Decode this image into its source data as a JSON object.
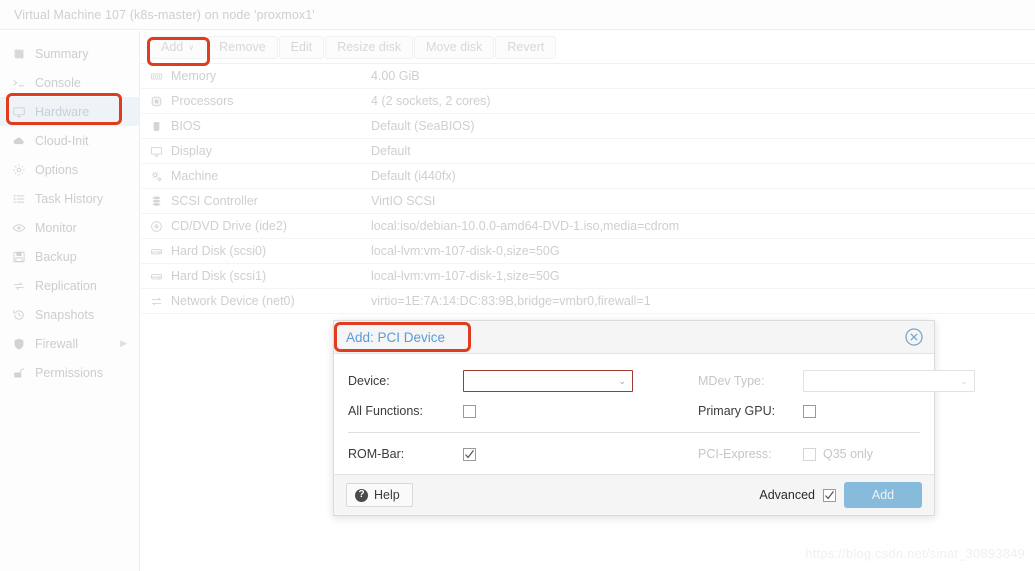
{
  "header": {
    "title": "Virtual Machine 107 (k8s-master) on node 'proxmox1'"
  },
  "sidebar": {
    "items": [
      {
        "label": "Summary",
        "icon": "book-icon",
        "selected": false,
        "submenu": false
      },
      {
        "label": "Console",
        "icon": "terminal-icon",
        "selected": false,
        "submenu": false
      },
      {
        "label": "Hardware",
        "icon": "monitor-icon",
        "selected": true,
        "submenu": false
      },
      {
        "label": "Cloud-Init",
        "icon": "cloud-icon",
        "selected": false,
        "submenu": false
      },
      {
        "label": "Options",
        "icon": "gear-icon",
        "selected": false,
        "submenu": false
      },
      {
        "label": "Task History",
        "icon": "list-icon",
        "selected": false,
        "submenu": false
      },
      {
        "label": "Monitor",
        "icon": "eye-icon",
        "selected": false,
        "submenu": false
      },
      {
        "label": "Backup",
        "icon": "floppy-icon",
        "selected": false,
        "submenu": false
      },
      {
        "label": "Replication",
        "icon": "sync-icon",
        "selected": false,
        "submenu": false
      },
      {
        "label": "Snapshots",
        "icon": "history-icon",
        "selected": false,
        "submenu": false
      },
      {
        "label": "Firewall",
        "icon": "shield-icon",
        "selected": false,
        "submenu": true
      },
      {
        "label": "Permissions",
        "icon": "unlock-icon",
        "selected": false,
        "submenu": false
      }
    ]
  },
  "toolbar": {
    "buttons": [
      {
        "label": "Add",
        "caret": true,
        "enabled": true
      },
      {
        "label": "Remove",
        "caret": false,
        "enabled": false
      },
      {
        "label": "Edit",
        "caret": false,
        "enabled": false
      },
      {
        "label": "Resize disk",
        "caret": false,
        "enabled": false
      },
      {
        "label": "Move disk",
        "caret": false,
        "enabled": false
      },
      {
        "label": "Revert",
        "caret": false,
        "enabled": false
      }
    ],
    "caret_glyph": "∨"
  },
  "hardware": {
    "rows": [
      {
        "icon": "memory-icon",
        "key": "Memory",
        "value": "4.00 GiB"
      },
      {
        "icon": "cpu-icon",
        "key": "Processors",
        "value": "4 (2 sockets, 2 cores)"
      },
      {
        "icon": "bios-icon",
        "key": "BIOS",
        "value": "Default (SeaBIOS)"
      },
      {
        "icon": "display-icon",
        "key": "Display",
        "value": "Default"
      },
      {
        "icon": "gears-icon",
        "key": "Machine",
        "value": "Default (i440fx)"
      },
      {
        "icon": "database-icon",
        "key": "SCSI Controller",
        "value": "VirtIO SCSI"
      },
      {
        "icon": "disc-icon",
        "key": "CD/DVD Drive (ide2)",
        "value": "local:iso/debian-10.0.0-amd64-DVD-1.iso,media=cdrom"
      },
      {
        "icon": "harddisk-icon",
        "key": "Hard Disk (scsi0)",
        "value": "local-lvm:vm-107-disk-0,size=50G"
      },
      {
        "icon": "harddisk-icon",
        "key": "Hard Disk (scsi1)",
        "value": "local-lvm:vm-107-disk-1,size=50G"
      },
      {
        "icon": "network-icon",
        "key": "Network Device (net0)",
        "value": "virtio=1E:7A:14:DC:83:9B,bridge=vmbr0,firewall=1"
      }
    ]
  },
  "dialog": {
    "title": "Add: PCI Device",
    "close_icon": "close-circle-icon",
    "fields": {
      "device_label": "Device:",
      "device_value": "",
      "mdev_label": "MDev Type:",
      "mdev_value": "",
      "all_functions_label": "All Functions:",
      "all_functions_checked": false,
      "primary_gpu_label": "Primary GPU:",
      "primary_gpu_checked": false,
      "rom_bar_label": "ROM-Bar:",
      "rom_bar_checked": true,
      "pci_express_label": "PCI-Express:",
      "pci_express_checked": false,
      "pci_express_note": "Q35 only"
    },
    "footer": {
      "help_label": "Help",
      "help_glyph": "?",
      "advanced_label": "Advanced",
      "advanced_checked": true,
      "submit_label": "Add"
    }
  },
  "watermark": {
    "text": "https://blog.csdn.net/sinat_30893849"
  },
  "colors": {
    "annotation": "#e03c1f",
    "dialog_title": "#5b9bd5",
    "submit_button": "#87bbdc",
    "selected_nav": "#eef3f7",
    "invalid_border": "#9c3b2e"
  }
}
